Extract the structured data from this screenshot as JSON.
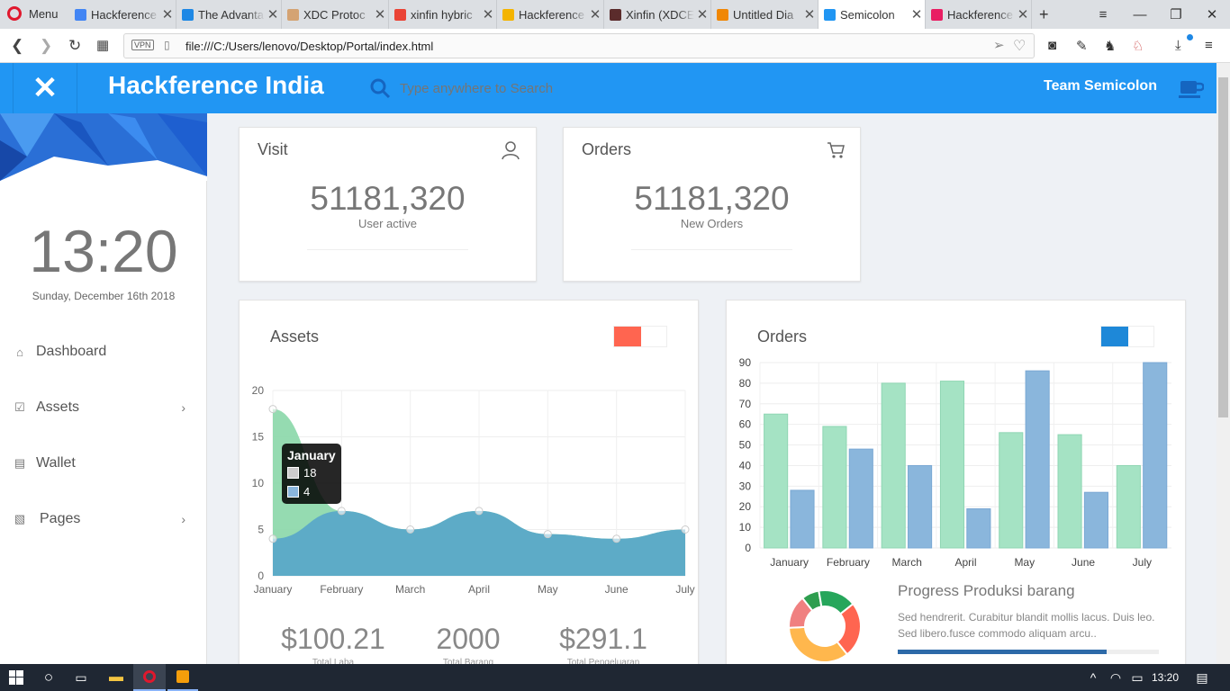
{
  "browser": {
    "menu_label": "Menu",
    "tabs": [
      {
        "title": "Hackference",
        "color": "#4285f4"
      },
      {
        "title": "The Advanta",
        "color": "#1e88e5"
      },
      {
        "title": "XDC Protoc",
        "color": "#d4a373"
      },
      {
        "title": "xinfin hybric",
        "color": "#ea4335"
      },
      {
        "title": "Hackference",
        "color": "#f4b400"
      },
      {
        "title": "Xinfin (XDCE",
        "color": "#5b2c2c"
      },
      {
        "title": "Untitled Dia",
        "color": "#f08705"
      },
      {
        "title": "Semicolon",
        "color": "#2196f3"
      },
      {
        "title": "Hackference",
        "color": "#e91e63"
      }
    ],
    "active_tab": 7,
    "vpn_label": "VPN",
    "url": "file:///C:/Users/lenovo/Desktop/Portal/index.html"
  },
  "header": {
    "brand": "Hackference India",
    "search_placeholder": "Type anywhere to Search",
    "team": "Team Semicolon",
    "accent": "#2196f3"
  },
  "sidebar": {
    "time": "13:20",
    "date": "Sunday, December 16th 2018",
    "items": [
      {
        "label": "Dashboard",
        "icon": "home-icon"
      },
      {
        "label": "Assets",
        "icon": "check-square-icon"
      },
      {
        "label": "Wallet",
        "icon": "calendar-icon"
      },
      {
        "label": "Pages",
        "icon": "file-code-icon"
      }
    ]
  },
  "cards": {
    "visit": {
      "title": "Visit",
      "value": "51181,320",
      "caption": "User active"
    },
    "orders": {
      "title": "Orders",
      "value": "51181,320",
      "caption": "New Orders"
    }
  },
  "assets": {
    "title": "Assets",
    "legend_color": "#ff6550",
    "tooltip": {
      "title": "January",
      "values": [
        "18",
        "4"
      ]
    },
    "stats": [
      {
        "value": "$100.21",
        "label": "Total Laba"
      },
      {
        "value": "2000",
        "label": "Total Barang"
      },
      {
        "value": "$291.1",
        "label": "Total Pengeluaran"
      }
    ]
  },
  "orders_panel": {
    "title": "Orders",
    "legend_color": "#1e88d8",
    "progress_title": "Progress Produksi barang",
    "progress_text": "Sed hendrerit. Curabitur blandit mollis lacus. Duis leo. Sed libero.fusce commodo aliquam arcu..",
    "progress_value": 0.8
  },
  "taskbar": {
    "time": "13:20"
  },
  "chart_data": [
    {
      "type": "area",
      "categories": [
        "January",
        "February",
        "March",
        "April",
        "May",
        "June",
        "July"
      ],
      "ylim": [
        0,
        20
      ],
      "yticks": [
        0,
        5,
        10,
        15,
        20
      ],
      "series": [
        {
          "values": [
            18,
            7,
            5,
            7,
            4.5,
            4,
            5
          ],
          "color": "#8ad7a8"
        },
        {
          "values": [
            4,
            7,
            5,
            7,
            4.5,
            4,
            5
          ],
          "color": "#5aa9c8"
        }
      ]
    },
    {
      "type": "bar",
      "categories": [
        "January",
        "February",
        "March",
        "April",
        "May",
        "June",
        "July"
      ],
      "ylim": [
        0,
        90
      ],
      "yticks": [
        0,
        10,
        20,
        30,
        40,
        50,
        60,
        70,
        80,
        90
      ],
      "series": [
        {
          "values": [
            65,
            59,
            80,
            81,
            56,
            55,
            40
          ],
          "color": "#a5e3c4"
        },
        {
          "values": [
            28,
            48,
            40,
            19,
            86,
            27,
            90
          ],
          "color": "#8ab6dc"
        }
      ]
    },
    {
      "type": "pie",
      "values": [
        25,
        35,
        15,
        8,
        17
      ],
      "colors": [
        "#ff6550",
        "#ffb74d",
        "#f08080",
        "#2e9e4f",
        "#26a65b"
      ]
    }
  ]
}
